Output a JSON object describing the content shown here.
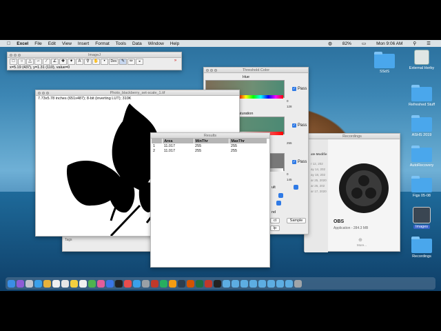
{
  "menubar": {
    "app": "Excel",
    "items": [
      "File",
      "Edit",
      "View",
      "Insert",
      "Format",
      "Tools",
      "Data",
      "Window",
      "Help"
    ],
    "battery": "82%",
    "time": "Mon 9:06 AM"
  },
  "toolbar_window": {
    "title": "ImageJ",
    "status": "x=5.19 (437), y=1.31 (110), value=0",
    "tool_dev": "Dev"
  },
  "image_window": {
    "title": "Photo_blackberry_set-scale_1.tif",
    "info": "7.73x5.78 inches (651x487); 8-bit (inverting LUT); 310K"
  },
  "threshold": {
    "title": "Threshold Color",
    "hue": "Hue",
    "saturation": "aturation",
    "pass": "Pass",
    "num_0": "0",
    "num_128": "128",
    "num_255": "255",
    "num_145": "145",
    "ult": "ult",
    "nd": "nd",
    "ct": "ct",
    "lp": "lp",
    "sample": "Sample"
  },
  "finder": {
    "title": "Recordings",
    "date_header": "ate Modifie",
    "dates": [
      "r 12, 202",
      "ay 14, 202",
      "ay 18, 202",
      "ar 25, 2020",
      "ar 26, 202",
      "ar 17, 2020"
    ],
    "app_name": "OBS",
    "app_info": "Application - 284.3 MB",
    "more": "More..."
  },
  "bg_window": {
    "tags": "Tags"
  },
  "results": {
    "title": "Results",
    "columns": [
      "",
      "Area",
      "MinThr",
      "MaxThr"
    ],
    "rows": [
      [
        "1",
        "11.017",
        "255",
        "255"
      ],
      [
        "2",
        "11.017",
        "255",
        "255"
      ]
    ]
  },
  "desktop": [
    {
      "label": "SSdS",
      "type": "folder"
    },
    {
      "label": "External Herby",
      "type": "drive"
    },
    {
      "label": "Refreshed Stuff",
      "type": "folder"
    },
    {
      "label": "ASHS 2019",
      "type": "folder"
    },
    {
      "label": "AutoRecovery",
      "type": "folder"
    },
    {
      "label": "Figs 05-08",
      "type": "folder"
    },
    {
      "label": "Images",
      "type": "drive2"
    },
    {
      "label": "Recordings",
      "type": "folder"
    }
  ]
}
